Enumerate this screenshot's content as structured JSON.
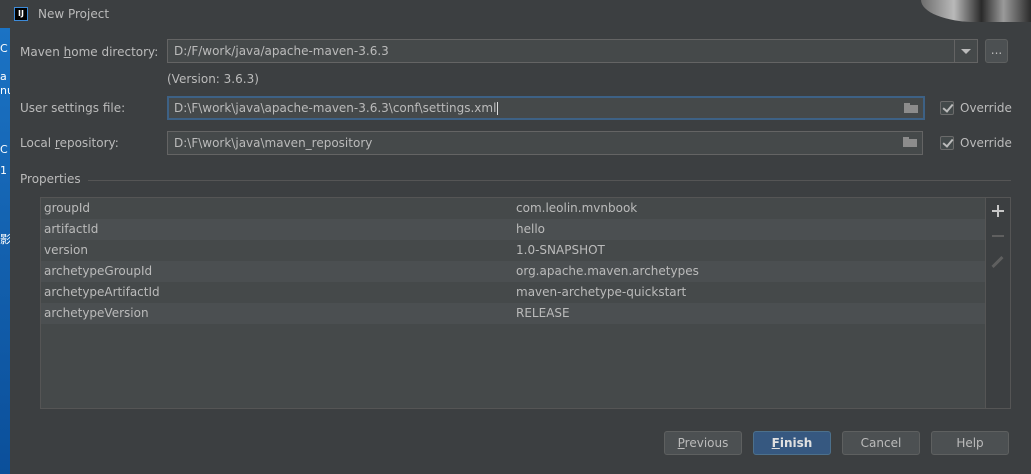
{
  "window": {
    "title": "New Project",
    "app_icon": "intellij-icon"
  },
  "desktop": {
    "glyphs": [
      "C",
      "a",
      "nu",
      "C",
      "1",
      "",
      "影"
    ]
  },
  "maven": {
    "home_label_pre": "Maven ",
    "home_label_mn": "h",
    "home_label_post": "ome directory:",
    "home_value": "D:/F/work/java/apache-maven-3.6.3",
    "browse_label": "...",
    "version_note": "(Version: 3.6.3)",
    "settings_label": "User settings file:",
    "settings_value": "D:\\F\\work\\java\\apache-maven-3.6.3\\conf\\settings.xml",
    "settings_override": "Override",
    "repo_label_pre": "Local ",
    "repo_label_mn": "r",
    "repo_label_post": "epository:",
    "repo_value": "D:\\F\\work\\java\\maven_repository",
    "repo_override": "Override"
  },
  "properties": {
    "title": "Properties",
    "rows": [
      {
        "key": "groupId",
        "value": "com.leolin.mvnbook"
      },
      {
        "key": "artifactId",
        "value": "hello"
      },
      {
        "key": "version",
        "value": "1.0-SNAPSHOT"
      },
      {
        "key": "archetypeGroupId",
        "value": "org.apache.maven.archetypes"
      },
      {
        "key": "archetypeArtifactId",
        "value": "maven-archetype-quickstart"
      },
      {
        "key": "archetypeVersion",
        "value": "RELEASE"
      }
    ]
  },
  "buttons": {
    "previous_mn": "P",
    "previous_rest": "revious",
    "finish_mn": "F",
    "finish_rest": "inish",
    "cancel": "Cancel",
    "help": "Help"
  },
  "colors": {
    "background": "#3c3f41",
    "field": "#45494a",
    "focus_border": "#3d6185",
    "primary_button": "#365880"
  }
}
